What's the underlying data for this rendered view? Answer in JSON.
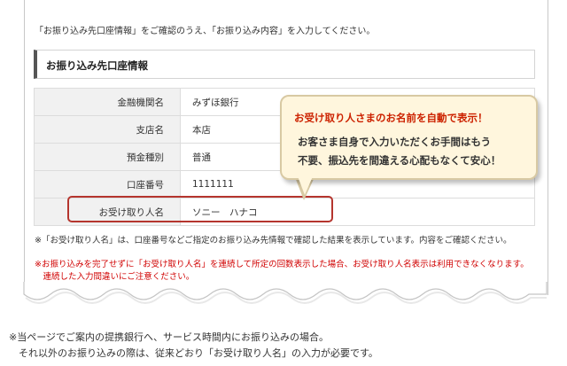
{
  "instruction": "「お振り込み先口座情報」をご確認のうえ、「お振り込み内容」を入力してください。",
  "section_title": "お振り込み先口座情報",
  "rows": [
    {
      "label": "金融機関名",
      "value": "みずほ銀行"
    },
    {
      "label": "支店名",
      "value": "本店"
    },
    {
      "label": "預金種別",
      "value": "普通"
    },
    {
      "label": "口座番号",
      "value": "1111111"
    },
    {
      "label": "お受け取り人名",
      "value": "ソニー　ハナコ"
    }
  ],
  "callout": {
    "title": "お受け取り人さまのお名前を自動で表示！",
    "body_line1": "お客さま自身で入力いただくお手間はもう",
    "body_line2": "不要、振込先を間違える心配もなくて安心！"
  },
  "note_gray": "※「お受け取り人名」は、口座番号などご指定のお振り込み先情報で確認した結果を表示しています。内容をご確認ください。",
  "note_red_line1": "※お振り込みを完了せずに「お受け取り人名」を連続して所定の回数表示した場合、お受け取り人名表示は利用できなくなります。",
  "note_red_line2": "　連続した入力間違いにご注意ください。",
  "footnote_line1": "※当ページでご案内の提携銀行へ、サービス時間内にお振り込みの場合。",
  "footnote_line2": "　それ以外のお振り込みの際は、従来どおり「お受け取り人名」の入力が必要です。",
  "colors": {
    "callout_title": "#cc2200",
    "highlight_border": "#b5352e",
    "warning_text": "#d00000"
  }
}
